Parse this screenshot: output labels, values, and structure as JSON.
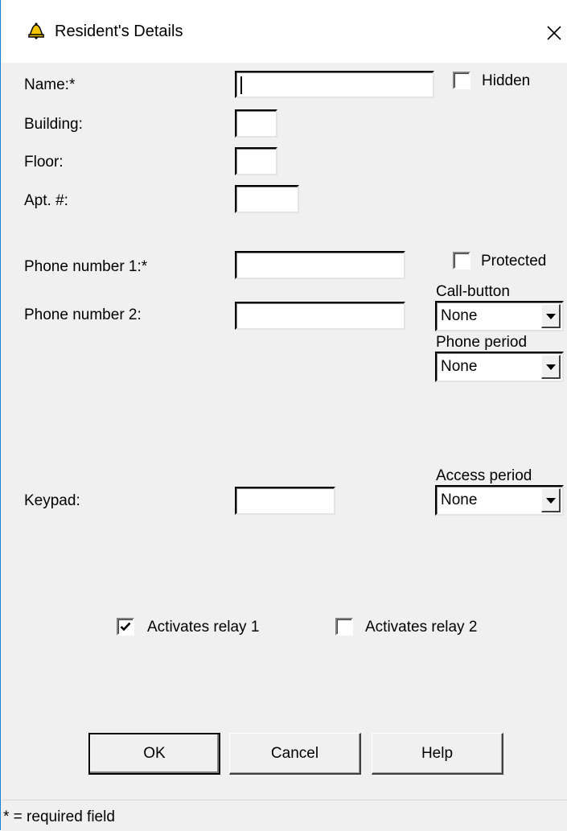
{
  "window": {
    "title": "Resident's Details",
    "accent_color": "#1883d7"
  },
  "labels": {
    "name": "Name:*",
    "building": "Building:",
    "floor": "Floor:",
    "apt": "Apt. #:",
    "phone1": "Phone number 1:*",
    "phone2": "Phone number 2:",
    "keypad": "Keypad:"
  },
  "fields": {
    "name": "",
    "building": "",
    "floor": "",
    "apt": "",
    "phone1": "",
    "phone2": "",
    "keypad": ""
  },
  "checkboxes": {
    "hidden": {
      "label": "Hidden",
      "checked": false
    },
    "protected": {
      "label": "Protected",
      "checked": false
    },
    "relay1": {
      "label": "Activates relay 1",
      "checked": true
    },
    "relay2": {
      "label": "Activates relay 2",
      "checked": false
    }
  },
  "selects": {
    "call_button": {
      "label": "Call-button",
      "value": "None"
    },
    "phone_period": {
      "label": "Phone period",
      "value": "None"
    },
    "access_period": {
      "label": "Access period",
      "value": "None"
    }
  },
  "buttons": {
    "ok": "OK",
    "cancel": "Cancel",
    "help": "Help"
  },
  "status": {
    "text": "* = required field"
  },
  "icons": {
    "app": "bell-icon",
    "close": "close-icon",
    "check": "checkmark-icon",
    "dropdown": "chevron-down-icon"
  }
}
